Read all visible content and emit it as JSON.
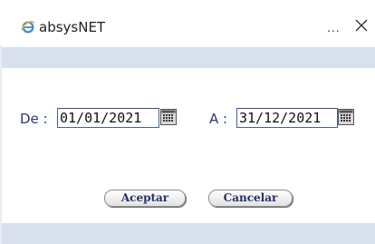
{
  "window": {
    "title": "absysNET",
    "more_label": "...",
    "icon": "ie-browser-icon",
    "close_icon": "close-icon"
  },
  "form": {
    "from_label": "De :",
    "from_value": "01/01/2021",
    "to_label": "A :",
    "to_value": "31/12/2021",
    "calendar_icon": "calendar-icon"
  },
  "buttons": {
    "accept_label": "Aceptar",
    "cancel_label": "Cancelar"
  },
  "colors": {
    "band": "#d7e0ec",
    "label": "#2b3a7a",
    "input_border": "#4a5fa0"
  }
}
